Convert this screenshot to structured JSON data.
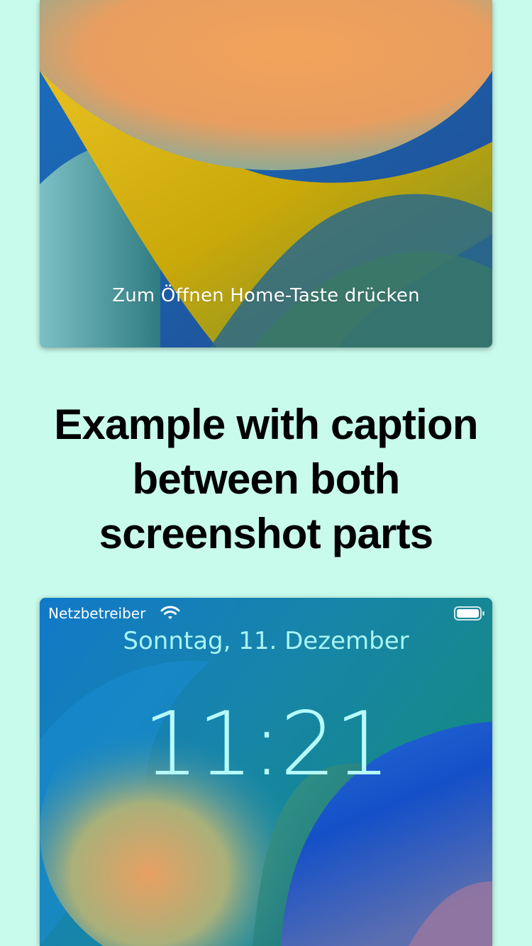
{
  "top_screenshot": {
    "unlock_hint": "Zum Öffnen Home-Taste drücken"
  },
  "caption": {
    "line1": "Example with caption",
    "line2": "between both",
    "line3": "screenshot parts"
  },
  "bottom_screenshot": {
    "status_bar": {
      "carrier": "Netzbetreiber",
      "wifi_icon": "wifi-icon",
      "battery_icon": "battery-icon"
    },
    "date": "Sonntag, 11. Dezember",
    "time": "11:21"
  },
  "colors": {
    "background": "#c8fbec",
    "caption_text": "#000000",
    "lock_text": "#b6fbfa"
  }
}
